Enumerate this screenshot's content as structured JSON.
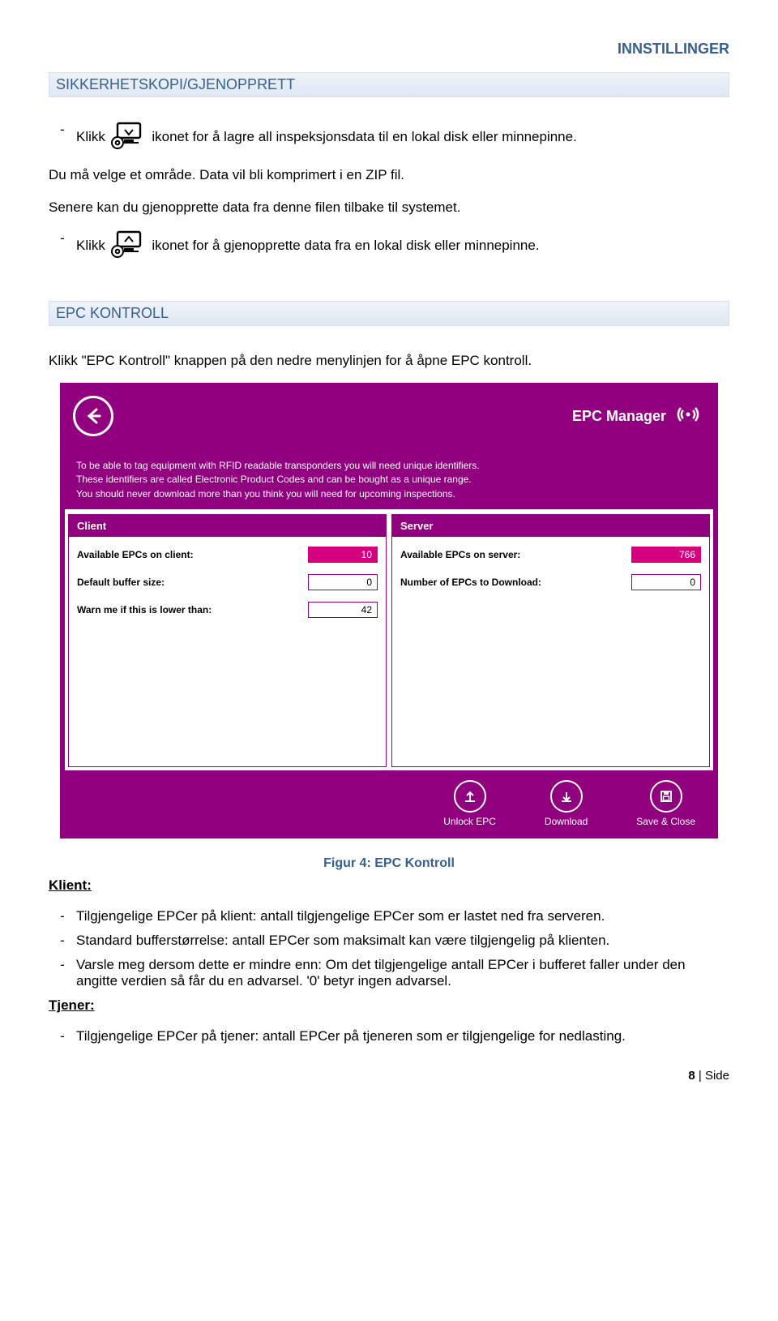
{
  "corner_header": "INNSTILLINGER",
  "heading_backup": "SIKKERHETSKOPI/GJENOPPRETT",
  "b1_prefix": "Klikk ",
  "b1_suffix": " ikonet for å lagre all inspeksjonsdata til en lokal disk eller minnepinne.",
  "p1": "Du må velge et område. Data vil bli komprimert i en ZIP fil.",
  "p2": "Senere kan du gjenopprette data fra denne filen tilbake til systemet.",
  "b2_prefix": "Klikk ",
  "b2_suffix": " ikonet for å gjenopprette data fra en lokal disk eller minnepinne.",
  "heading_epc": "EPC KONTROLL",
  "p3": "Klikk \"EPC Kontroll\" knappen på den nedre menylinjen for å åpne EPC kontroll.",
  "epc": {
    "title": "EPC Manager",
    "info_l1": "To be able to tag equipment with RFID readable transponders you will need unique identifiers.",
    "info_l2": "These identifiers are called Electronic Product Codes and can be bought as a unique range.",
    "info_l3": "You should never download more than you think you will need for upcoming inspections.",
    "client_head": "Client",
    "server_head": "Server",
    "client": {
      "available_lbl": "Available EPCs on client:",
      "available_val": "10",
      "buffer_lbl": "Default buffer size:",
      "buffer_val": "0",
      "warn_lbl": "Warn me if this is lower than:",
      "warn_val": "42"
    },
    "server": {
      "available_lbl": "Available EPCs on server:",
      "available_val": "766",
      "download_lbl": "Number of EPCs to Download:",
      "download_val": "0"
    },
    "btn_unlock": "Unlock EPC",
    "btn_download": "Download",
    "btn_save": "Save & Close"
  },
  "fig_caption": "Figur 4: EPC Kontroll",
  "klient_head": "Klient:",
  "k1": "Tilgjengelige EPCer på klient: antall tilgjengelige EPCer som er lastet ned fra serveren.",
  "k2": "Standard bufferstørrelse: antall EPCer som maksimalt kan være tilgjengelig på klienten.",
  "k3": "Varsle meg dersom dette er mindre enn:  Om det tilgjengelige antall EPCer i bufferet faller under den angitte verdien så får du en advarsel.  '0' betyr ingen advarsel.",
  "tjener_head": "Tjener:",
  "t1": "Tilgjengelige EPCer på tjener: antall EPCer på tjeneren som er tilgjengelige for nedlasting.",
  "page_no_prefix": "8 ",
  "page_no_suffix": "| Side"
}
